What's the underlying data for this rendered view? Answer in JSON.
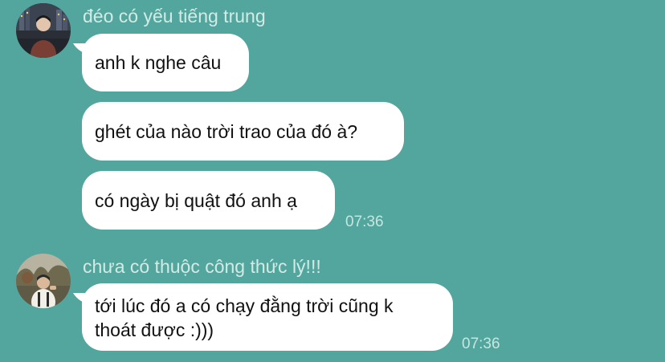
{
  "groups": [
    {
      "sender": "đéo có yếu tiếng trung",
      "avatar": "avatar-photo-city-night",
      "messages": [
        {
          "text": "anh k nghe câu"
        },
        {
          "text": "ghét của nào trời trao của đó à?"
        },
        {
          "text": "có ngày bị quật đó anh ạ",
          "time": "07:36"
        }
      ]
    },
    {
      "sender": "chưa có thuộc công thức lý!!!",
      "avatar": "avatar-photo-outdoor-park",
      "messages": [
        {
          "text": "tới lúc đó a có chạy đằng trời cũng k\nthoát được :)))",
          "time": "07:36"
        }
      ]
    }
  ],
  "colors": {
    "background": "#53a69d",
    "bubble": "#ffffff",
    "meta_text": "#d2ebe7"
  }
}
